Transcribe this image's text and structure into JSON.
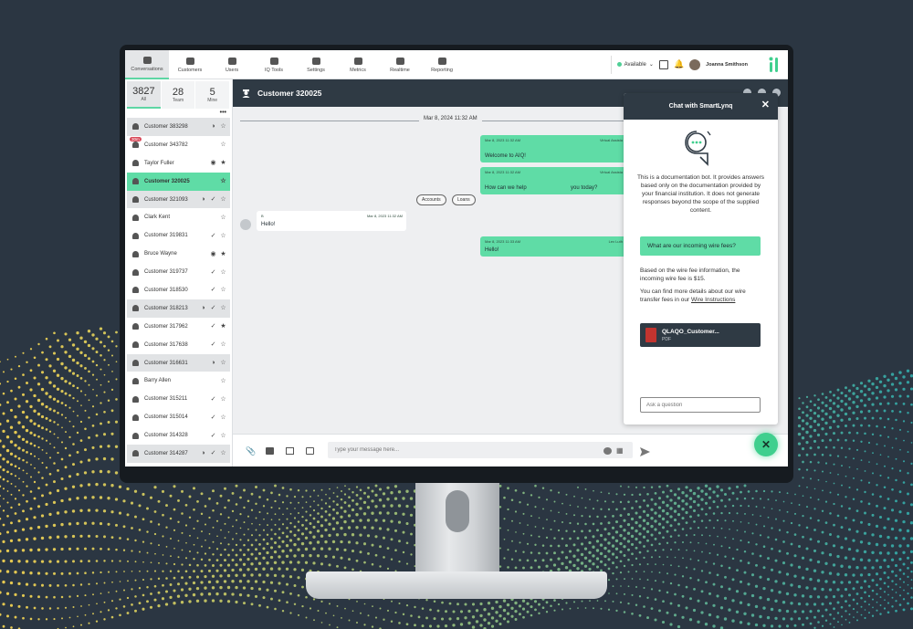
{
  "nav": {
    "items": [
      {
        "label": "Conversations",
        "icon": "chat-bubbles-icon",
        "active": true
      },
      {
        "label": "Customers",
        "icon": "customers-icon"
      },
      {
        "label": "Users",
        "icon": "users-icon"
      },
      {
        "label": "IQ Tools",
        "icon": "toolbox-icon"
      },
      {
        "label": "Settings",
        "icon": "sliders-icon"
      },
      {
        "label": "Metrics",
        "icon": "chart-icon"
      },
      {
        "label": "Realtime",
        "icon": "clock-icon"
      },
      {
        "label": "Reporting",
        "icon": "report-icon"
      }
    ],
    "status": "Available",
    "user_name": "Joanna Smithson"
  },
  "counts": [
    {
      "num": "3827",
      "label": "All"
    },
    {
      "num": "28",
      "label": "Team"
    },
    {
      "num": "5",
      "label": "Mine"
    }
  ],
  "conversations": [
    {
      "name": "Customer 383298",
      "style": "grey",
      "icons": [
        "audio",
        "star"
      ]
    },
    {
      "name": "Customer 343782",
      "style": "",
      "badge": "30m",
      "icons": [
        "star"
      ]
    },
    {
      "name": "Taylor Fuller",
      "style": "",
      "icons": [
        "muted",
        "star-filled"
      ]
    },
    {
      "name": "Customer 320025",
      "style": "sel",
      "icons": [
        "star"
      ]
    },
    {
      "name": "Customer 321093",
      "style": "grey",
      "icons": [
        "audio",
        "check",
        "star"
      ]
    },
    {
      "name": "Clark Kent",
      "style": "",
      "icons": [
        "star"
      ]
    },
    {
      "name": "Customer 319831",
      "style": "",
      "icons": [
        "check",
        "star"
      ]
    },
    {
      "name": "Bruce Wayne",
      "style": "",
      "icons": [
        "muted",
        "star-filled"
      ]
    },
    {
      "name": "Customer 319737",
      "style": "",
      "icons": [
        "check",
        "star"
      ]
    },
    {
      "name": "Customer 318530",
      "style": "",
      "icons": [
        "check",
        "star"
      ]
    },
    {
      "name": "Customer 318213",
      "style": "grey",
      "icons": [
        "audio",
        "check",
        "star"
      ]
    },
    {
      "name": "Customer 317962",
      "style": "",
      "icons": [
        "check",
        "star-filled"
      ]
    },
    {
      "name": "Customer 317638",
      "style": "",
      "icons": [
        "check",
        "star"
      ]
    },
    {
      "name": "Customer 316631",
      "style": "grey",
      "icons": [
        "audio",
        "star"
      ]
    },
    {
      "name": "Barry Allen",
      "style": "",
      "icons": [
        "star"
      ]
    },
    {
      "name": "Customer 315211",
      "style": "",
      "icons": [
        "check",
        "star"
      ]
    },
    {
      "name": "Customer 315014",
      "style": "",
      "icons": [
        "check",
        "star"
      ]
    },
    {
      "name": "Customer 314328",
      "style": "",
      "icons": [
        "check",
        "star"
      ]
    },
    {
      "name": "Customer 314287",
      "style": "grey",
      "icons": [
        "audio",
        "check",
        "star"
      ]
    }
  ],
  "chat": {
    "title": "Customer 320025",
    "date_divider": "Mar 8, 2024 11:32 AM",
    "msg1": {
      "meta": "Mar 8, 2023 11:32 AM",
      "sender": "Virtual Assista",
      "text": "Welcome to AIQ!"
    },
    "msg2": {
      "meta": "Mar 8, 2023 11:32 AM",
      "sender": "Virtual Assista",
      "text_a": "How can we help",
      "text_b": "you today?"
    },
    "chips": [
      "Accounts",
      "Loans"
    ],
    "msg3": {
      "sender": "B",
      "meta": "Mar 8, 2023 11:32 AM",
      "text": "Hello!"
    },
    "msg4": {
      "meta": "Mar 8, 2023 11:33 AM",
      "sender": "Lex Luth",
      "text": "Hello!"
    },
    "input_placeholder": "Type your message here..."
  },
  "smartlynq": {
    "title": "Chat with SmartLynq",
    "intro": "This is a documentation bot. It provides answers based only on the documentation provided by your financial institution. It does not generate responses beyond the scope of the supplied content.",
    "question": "What are our incoming wire fees?",
    "answer1": "Based on the wire fee information, the incoming wire fee is $15.",
    "answer2_pre": "You can find more details about our wire transfer fees in our ",
    "answer2_link": "Wire Instructions",
    "file_name": "QLAQO_Customer...",
    "file_type": "PDF",
    "ask_placeholder": "Ask a question"
  },
  "colors": {
    "accent": "#5fdca6",
    "header": "#2f3a44",
    "pdf": "#c2342f"
  }
}
